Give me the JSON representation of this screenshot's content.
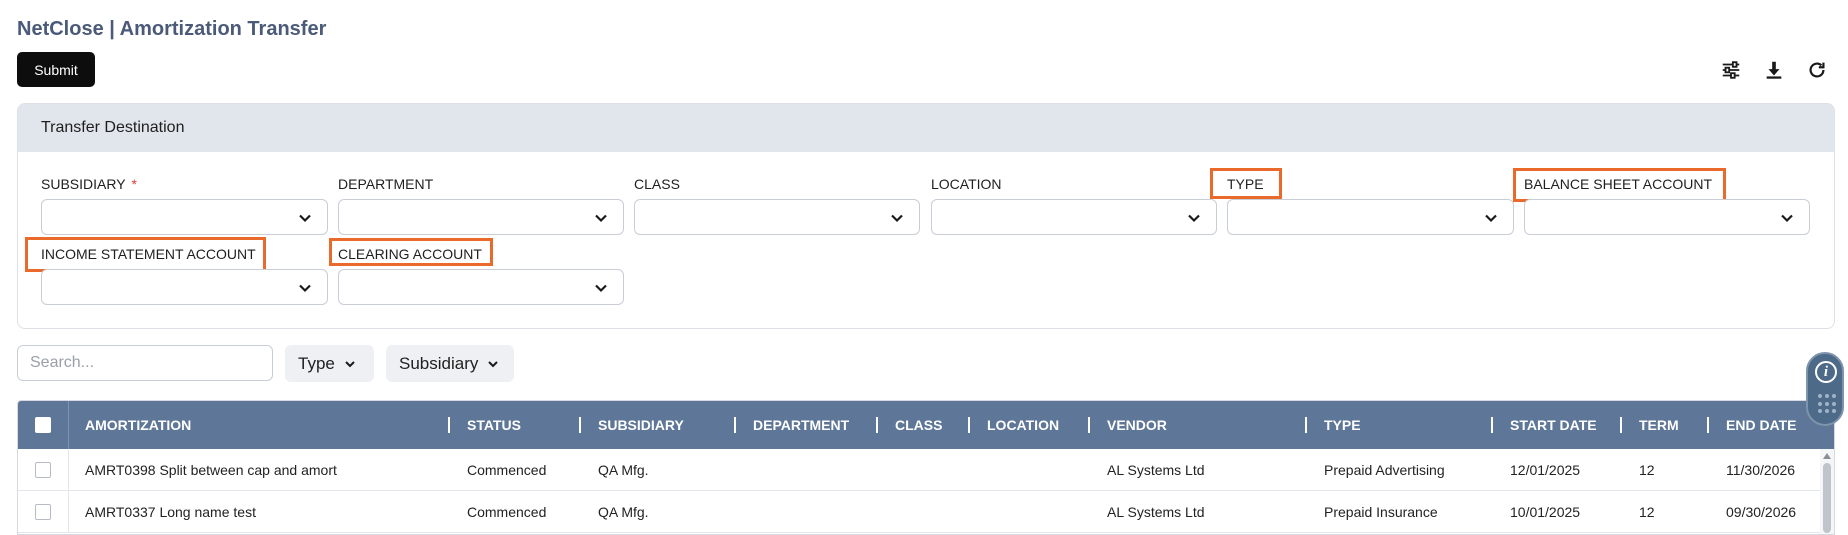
{
  "app": {
    "title": "NetClose | Amortization Transfer"
  },
  "toolbar": {
    "submit_label": "Submit",
    "icons": [
      "sliders-icon",
      "download-icon",
      "refresh-icon"
    ]
  },
  "transfer_destination": {
    "header": "Transfer Destination",
    "fields": {
      "subsidiary": {
        "label": "SUBSIDIARY",
        "required": "*",
        "value": ""
      },
      "department": {
        "label": "DEPARTMENT",
        "value": ""
      },
      "class": {
        "label": "CLASS",
        "value": ""
      },
      "location": {
        "label": "LOCATION",
        "value": ""
      },
      "type": {
        "label": "TYPE",
        "value": "",
        "highlighted": true
      },
      "balance_sheet_account": {
        "label": "BALANCE SHEET ACCOUNT",
        "value": "",
        "highlighted": true
      },
      "income_statement_account": {
        "label": "INCOME STATEMENT ACCOUNT",
        "value": "",
        "highlighted": true
      },
      "clearing_account": {
        "label": "CLEARING ACCOUNT",
        "value": "",
        "highlighted": true
      }
    },
    "highlight_color": "#ea6a2c"
  },
  "filters": {
    "search_placeholder": "Search...",
    "type_label": "Type",
    "subsidiary_label": "Subsidiary"
  },
  "table": {
    "columns": {
      "amortization": "AMORTIZATION",
      "status": "STATUS",
      "subsidiary": "SUBSIDIARY",
      "department": "DEPARTMENT",
      "class": "CLASS",
      "location": "LOCATION",
      "vendor": "VENDOR",
      "type": "TYPE",
      "start_date": "START DATE",
      "term": "TERM",
      "end_date": "END DATE"
    },
    "rows": [
      {
        "amortization": "AMRT0398 Split between cap and amort",
        "status": "Commenced",
        "subsidiary": "QA Mfg.",
        "department": "",
        "class": "",
        "location": "",
        "vendor": "AL Systems Ltd",
        "type": "Prepaid Advertising",
        "start_date": "12/01/2025",
        "term": "12",
        "end_date": "11/30/2026"
      },
      {
        "amortization": "AMRT0337 Long name test",
        "status": "Commenced",
        "subsidiary": "QA Mfg.",
        "department": "",
        "class": "",
        "location": "",
        "vendor": "AL Systems Ltd",
        "type": "Prepaid Insurance",
        "start_date": "10/01/2025",
        "term": "12",
        "end_date": "09/30/2026"
      }
    ],
    "header_color": "#5e7697"
  }
}
